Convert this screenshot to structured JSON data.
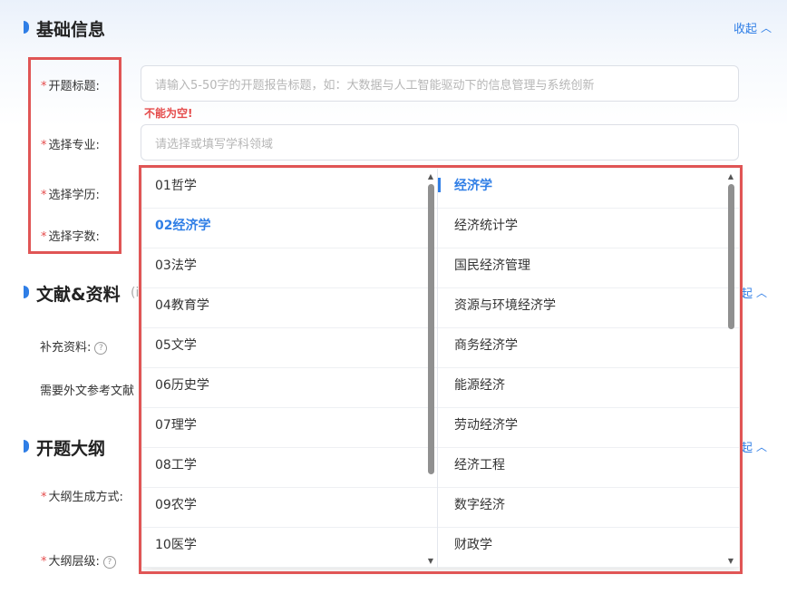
{
  "basic": {
    "title": "基础信息",
    "collapse": "收起",
    "fields": {
      "topic_label": "开题标题:",
      "topic_placeholder": "请输入5-50字的开题报告标题，如：大数据与人工智能驱动下的信息管理与系统创新",
      "error": "不能为空!",
      "major_label": "选择专业:",
      "major_placeholder": "请选择或填写学科领域",
      "degree_label": "选择学历:",
      "wordcount_label": "选择字数:"
    }
  },
  "literature": {
    "title": "文献&资料",
    "subtitle": "(i",
    "collapse": "起",
    "supplement_label": "补充资料:",
    "foreign_label": "需要外文参考文献"
  },
  "outline": {
    "title": "开题大纲",
    "collapse": "起",
    "method_label": "大纲生成方式:",
    "level_label": "大纲层级:"
  },
  "dropdown": {
    "disciplines": [
      "01哲学",
      "02经济学",
      "03法学",
      "04教育学",
      "05文学",
      "06历史学",
      "07理学",
      "08工学",
      "09农学",
      "10医学"
    ],
    "selected_discipline": 1,
    "majors": [
      "经济学",
      "经济统计学",
      "国民经济管理",
      "资源与环境经济学",
      "商务经济学",
      "能源经济",
      "劳动经济学",
      "经济工程",
      "数字经济",
      "财政学"
    ],
    "selected_major": 0
  },
  "colors": {
    "accent": "#2f7ee6",
    "error": "#e54b4b",
    "highlight_box": "#e05555"
  }
}
